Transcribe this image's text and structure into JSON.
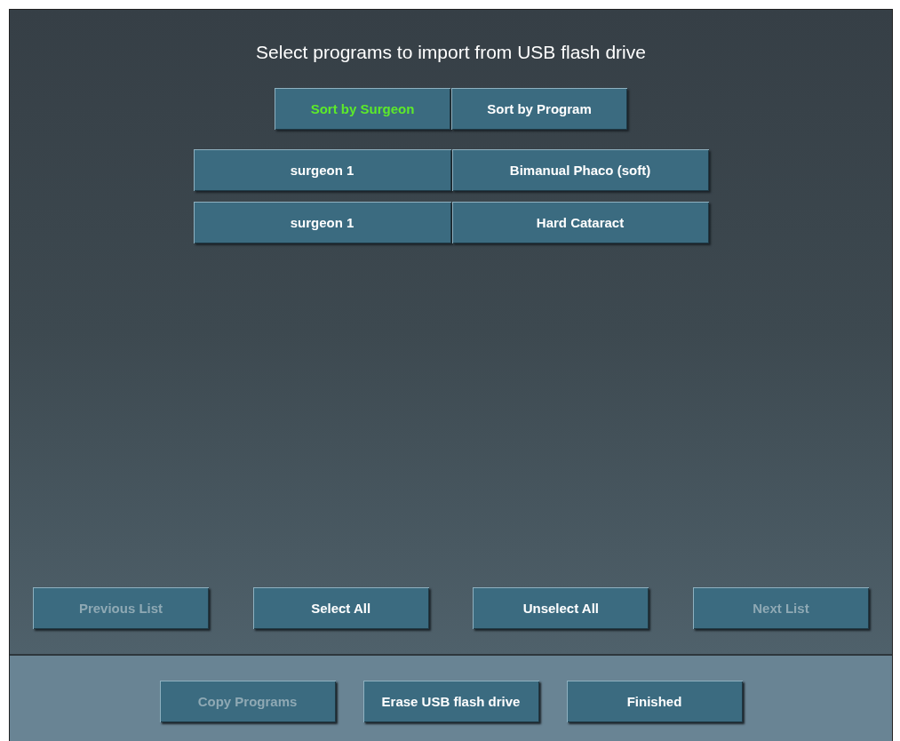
{
  "title": "Select programs to import from USB flash drive",
  "sort_tabs": [
    {
      "label": "Sort by Surgeon",
      "selected": true
    },
    {
      "label": "Sort by Program",
      "selected": false
    }
  ],
  "programs": [
    {
      "surgeon": "surgeon 1",
      "program": "Bimanual Phaco (soft)"
    },
    {
      "surgeon": "surgeon 1",
      "program": "Hard Cataract"
    }
  ],
  "list_buttons": [
    {
      "label": "Previous List",
      "disabled": true
    },
    {
      "label": "Select All",
      "disabled": false
    },
    {
      "label": "Unselect All",
      "disabled": false
    },
    {
      "label": "Next List",
      "disabled": true
    }
  ],
  "footer_buttons": [
    {
      "label": "Copy Programs",
      "disabled": true
    },
    {
      "label": "Erase USB flash drive",
      "disabled": false
    },
    {
      "label": "Finished",
      "disabled": false
    }
  ]
}
